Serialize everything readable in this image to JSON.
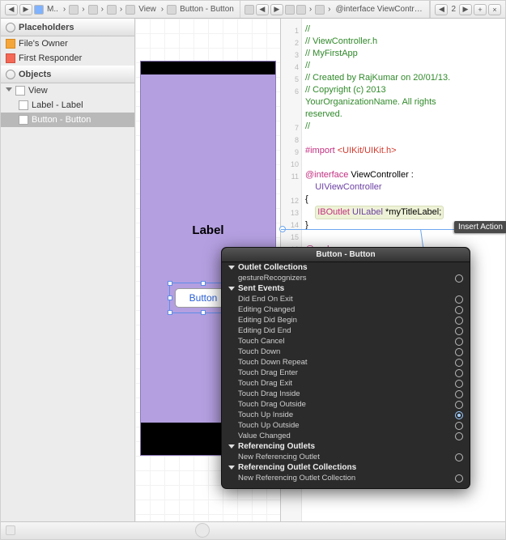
{
  "jumpbar": {
    "left_crumbs": [
      "M..",
      "",
      "",
      "",
      "View",
      "Button - Button"
    ],
    "right_crumb": "@interface ViewContr…"
  },
  "sidebar": {
    "placeholders_title": "Placeholders",
    "objects_title": "Objects",
    "files_owner": "File's Owner",
    "first_responder": "First Responder",
    "view": "View",
    "label_item": "Label - Label",
    "button_item": "Button - Button"
  },
  "canvas": {
    "label_text": "Label",
    "button_text": "Button"
  },
  "editor": {
    "line1": "//",
    "line2": "//  ViewController.h",
    "line3": "//  MyFirstApp",
    "line4": "//",
    "line5": "//  Created by RajKumar on 20/01/13.",
    "line6a": "//  Copyright (c) 2013",
    "line6b": "YourOrganizationName. All rights",
    "line6c": "reserved.",
    "line7": "//",
    "import_kw": "#import ",
    "import_lib": "<UIKit/UIKit.h>",
    "iface_kw": "@interface",
    "iface_name": " ViewController",
    "iface_colon": " :",
    "superclass": "UIViewController",
    "brace_open": "{",
    "outlet_kw": "IBOutlet ",
    "outlet_type": "UILabel",
    "outlet_var": " *myTitleLabel;",
    "brace_close": "}",
    "end": "@end",
    "insert_action": "Insert Action"
  },
  "popover": {
    "title": "Button - Button",
    "sections": [
      {
        "title": "Outlet Collections",
        "items": [
          {
            "label": "gestureRecognizers"
          }
        ]
      },
      {
        "title": "Sent Events",
        "items": [
          {
            "label": "Did End On Exit"
          },
          {
            "label": "Editing Changed"
          },
          {
            "label": "Editing Did Begin"
          },
          {
            "label": "Editing Did End"
          },
          {
            "label": "Touch Cancel"
          },
          {
            "label": "Touch Down"
          },
          {
            "label": "Touch Down Repeat"
          },
          {
            "label": "Touch Drag Enter"
          },
          {
            "label": "Touch Drag Exit"
          },
          {
            "label": "Touch Drag Inside"
          },
          {
            "label": "Touch Drag Outside"
          },
          {
            "label": "Touch Up Inside",
            "hot": true
          },
          {
            "label": "Touch Up Outside"
          },
          {
            "label": "Value Changed"
          }
        ]
      },
      {
        "title": "Referencing Outlets",
        "items": [
          {
            "label": "New Referencing Outlet"
          }
        ]
      },
      {
        "title": "Referencing Outlet Collections",
        "items": [
          {
            "label": "New Referencing Outlet Collection"
          }
        ]
      }
    ]
  }
}
